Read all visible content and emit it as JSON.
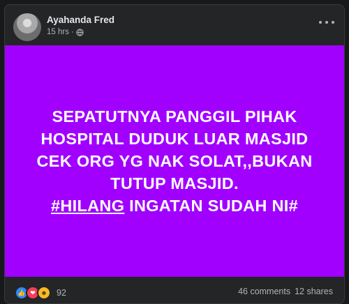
{
  "post": {
    "author": "Ayahanda Fred",
    "timestamp": "15 hrs",
    "separator": "·",
    "privacy_icon": "globe-icon",
    "image": {
      "background_color": "#a100ff",
      "lines": [
        "SEPATUTNYA PANGGIL PIHAK",
        "HOSPITAL DUDUK LUAR MASJID",
        "CEK ORG YG NAK SOLAT,,BUKAN",
        "TUTUP MASJID."
      ],
      "hashtag": "#HILANG",
      "last_line_rest": " INGATAN SUDAH NI#"
    },
    "reactions": {
      "icons": [
        "like-icon",
        "love-icon",
        "haha-icon"
      ],
      "count": "92"
    },
    "comments": "46 comments",
    "shares": "12 shares"
  }
}
